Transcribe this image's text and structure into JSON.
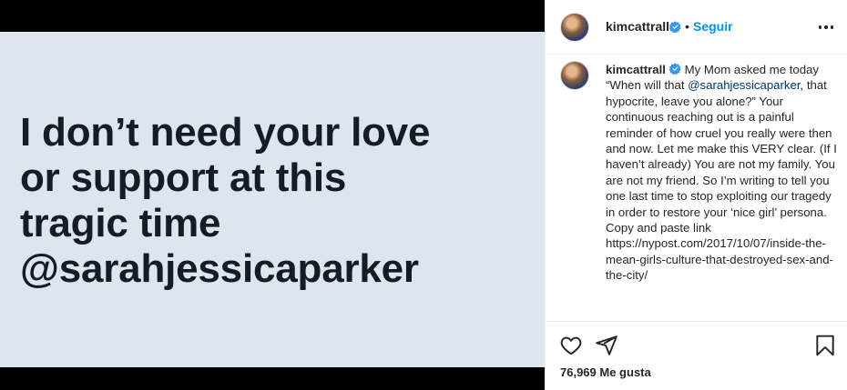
{
  "media": {
    "lines": [
      "I don’t need your love",
      "or support at this",
      "tragic time",
      "@sarahjessicaparker"
    ]
  },
  "header": {
    "username": "kimcattrall",
    "separator": "•",
    "follow_label": "Seguir",
    "more_icon": "more-options-icon"
  },
  "caption": {
    "username": "kimcattrall",
    "text_before_mention": " My Mom asked me today “When will that ",
    "mention": "@sarahjessicaparker",
    "text_after_mention": ", that hypocrite, leave you alone?” Your continuous reaching out is a painful reminder of how cruel you really were then and now. Let me make this VERY clear. (If I haven’t already) You are not my family. You are not my friend. So I’m writing to tell you one last time to stop exploiting our tragedy in order to restore your ‘nice girl’ persona. Copy and paste link https://nypost.com/2017/10/07/inside-the-mean-girls-culture-that-destroyed-sex-and-the-city/"
  },
  "actions": {
    "like_icon": "heart-icon",
    "share_icon": "paper-plane-icon",
    "save_icon": "bookmark-icon"
  },
  "likes": {
    "count": "76,969",
    "label": "Me gusta"
  },
  "colors": {
    "accent": "#0095f6",
    "verified": "#3897f0",
    "mention": "#00376b",
    "media_bg": "#dde6ee",
    "media_text": "#151c28"
  }
}
